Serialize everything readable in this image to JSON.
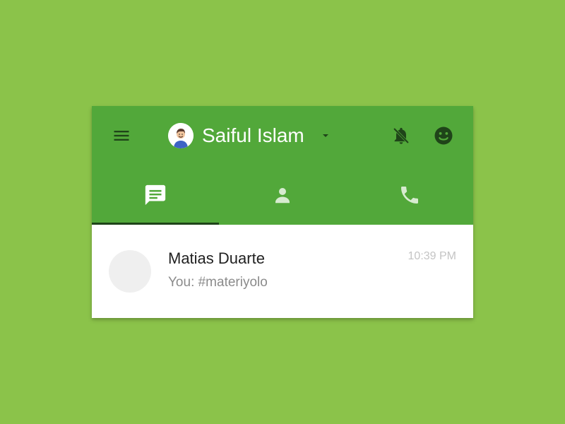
{
  "header": {
    "account_name": "Saiful Islam"
  },
  "tabs": [
    {
      "name": "messages",
      "icon": "message-icon",
      "active": true
    },
    {
      "name": "contacts",
      "icon": "person-icon",
      "active": false
    },
    {
      "name": "calls",
      "icon": "phone-icon",
      "active": false
    }
  ],
  "conversation": {
    "contact_name": "Matias Duarte",
    "preview": "You: #materiyolo",
    "time": "10:39 PM"
  },
  "colors": {
    "background": "#8bc34a",
    "appbar": "#52a83a",
    "icon_dark": "#1f4419",
    "icon_light": "#ffffff",
    "inactive_tab": "#d7ebd0"
  }
}
